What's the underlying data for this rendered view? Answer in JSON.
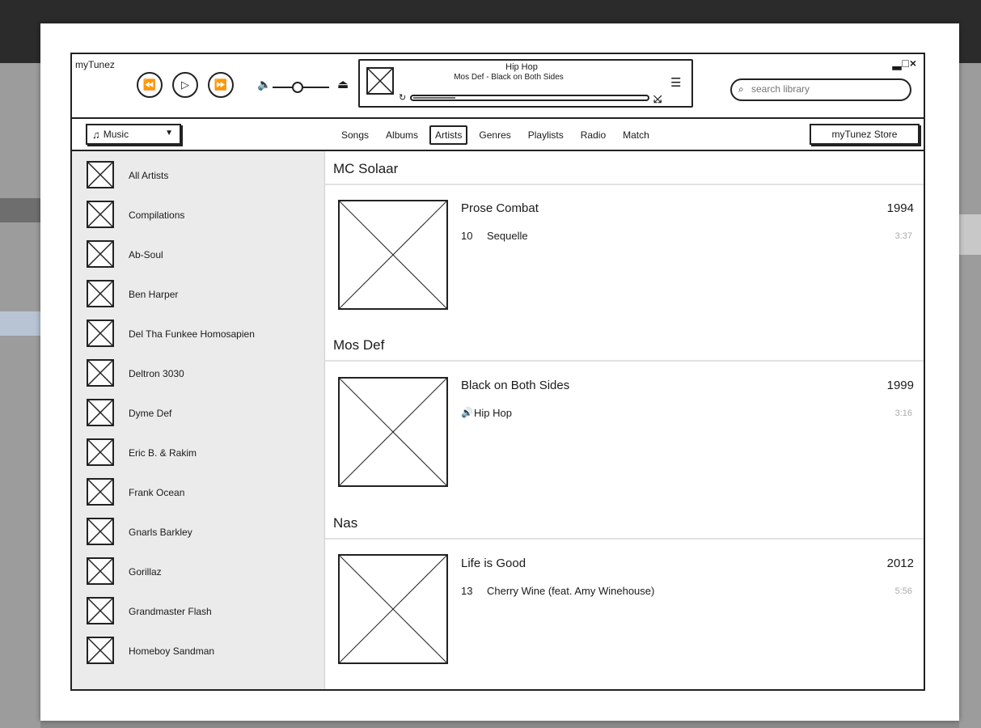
{
  "app": {
    "title": "myTunez",
    "window_controls": "▂□×"
  },
  "transport": {
    "prev": "⏪",
    "play": "▷",
    "next": "⏩",
    "volume_icon": "🔈",
    "eject": "⏏"
  },
  "now_playing": {
    "genre": "Hip Hop",
    "track": "Mos Def - Black on Both Sides",
    "repeat_icon": "↻",
    "shuffle_icon": "⤩",
    "list_icon": "☰",
    "progress": 0.18
  },
  "search": {
    "placeholder": "search library",
    "icon": "⌕"
  },
  "navbar": {
    "source_label": "Music",
    "source_icon": "♫",
    "caret": "▼",
    "tabs": [
      {
        "label": "Songs"
      },
      {
        "label": "Albums"
      },
      {
        "label": "Artists",
        "active": true
      },
      {
        "label": "Genres"
      },
      {
        "label": "Playlists"
      },
      {
        "label": "Radio"
      },
      {
        "label": "Match"
      }
    ],
    "store_label": "myTunez Store"
  },
  "sidebar": {
    "items": [
      {
        "label": "All Artists"
      },
      {
        "label": "Compilations"
      },
      {
        "label": "Ab-Soul"
      },
      {
        "label": "Ben Harper"
      },
      {
        "label": "Del Tha Funkee Homosapien"
      },
      {
        "label": "Deltron 3030"
      },
      {
        "label": "Dyme Def"
      },
      {
        "label": "Eric B. & Rakim"
      },
      {
        "label": "Frank Ocean"
      },
      {
        "label": "Gnarls Barkley"
      },
      {
        "label": "Gorillaz"
      },
      {
        "label": "Grandmaster Flash"
      },
      {
        "label": "Homeboy Sandman"
      }
    ]
  },
  "artists": [
    {
      "name": "MC Solaar",
      "album": "Prose Combat",
      "year": "1994",
      "track_num": "10",
      "track_title": "Sequelle",
      "track_time": "3:37",
      "playing": false
    },
    {
      "name": "Mos Def",
      "album": "Black on Both Sides",
      "year": "1999",
      "track_num": "",
      "track_title": "Hip Hop",
      "track_time": "3:16",
      "playing": true,
      "speaker_icon": "🔊"
    },
    {
      "name": "Nas",
      "album": "Life is Good",
      "year": "2012",
      "track_num": "13",
      "track_title": "Cherry Wine (feat. Amy Winehouse)",
      "track_time": "5:56",
      "playing": false
    }
  ]
}
